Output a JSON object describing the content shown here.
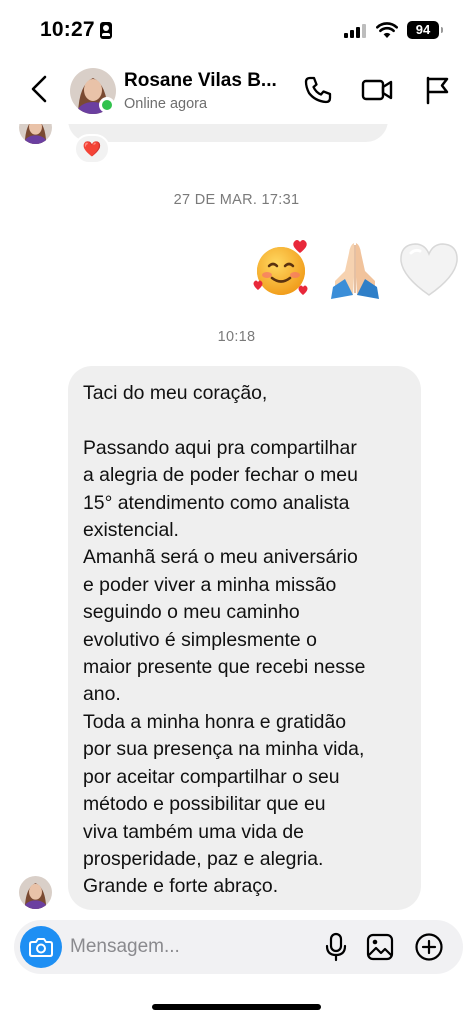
{
  "status_bar": {
    "time": "10:27",
    "battery_level": "94",
    "icons": [
      "id-card-icon",
      "signal-icon",
      "wifi-icon",
      "battery-icon"
    ]
  },
  "header": {
    "contact_name": "Rosane Vilas B...",
    "contact_status": "Online agora",
    "online_indicator_color": "#31c24d",
    "icons": [
      "back-icon",
      "phone-icon",
      "video-call-icon",
      "flag-icon"
    ]
  },
  "conversation": {
    "previous_message": {
      "reaction": "❤️"
    },
    "timestamp_1": "27 DE MAR. 17:31",
    "sent_emojis": [
      "🥰",
      "🙏🏻",
      "🤍"
    ],
    "timestamp_2": "10:18",
    "received_message": {
      "lines": [
        "Taci do meu coração,",
        "",
        "Passando aqui pra compartilhar",
        "a alegria de poder fechar o meu",
        "15° atendimento como analista",
        "existencial.",
        "Amanhã será o meu aniversário",
        "e poder viver a minha missão",
        "seguindo o meu caminho",
        "evolutivo é simplesmente o",
        "maior presente que recebi nesse",
        "ano.",
        "Toda a minha honra e gratidão",
        "por sua presença na minha vida,",
        "por aceitar compartilhar o seu",
        "método e possibilitar que eu",
        "viva também uma vida de",
        "prosperidade, paz e alegria.",
        "Grande e forte abraço."
      ]
    }
  },
  "composer": {
    "placeholder": "Mensagem...",
    "value": "",
    "accent_color": "#1e8ff3",
    "icons": [
      "camera-icon",
      "microphone-icon",
      "gallery-icon",
      "add-icon"
    ]
  }
}
